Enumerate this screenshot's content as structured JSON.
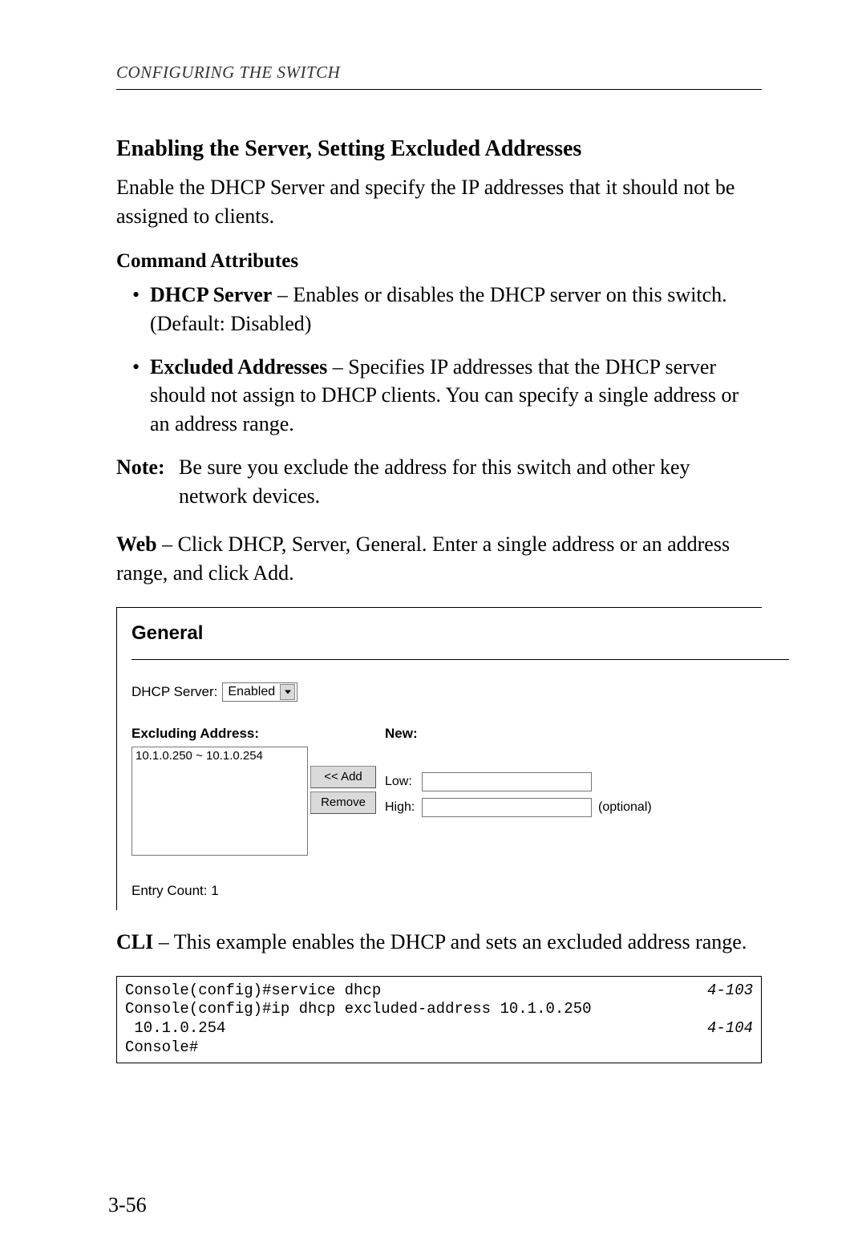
{
  "running_head": "CONFIGURING THE SWITCH",
  "section_title": "Enabling the Server, Setting Excluded Addresses",
  "intro": "Enable the DHCP Server and specify the IP addresses that it should not be assigned to clients.",
  "cmd_attr_title": "Command Attributes",
  "bullets": [
    {
      "bold": "DHCP Server",
      "rest": " – Enables or disables the DHCP server on this switch. (Default: Disabled)"
    },
    {
      "bold": "Excluded Addresses",
      "rest": " – Specifies IP addresses that the DHCP server should not assign to DHCP clients. You can specify a single address or an address range."
    }
  ],
  "note_label": "Note:",
  "note_body": "Be sure you exclude the address for this switch and other key network devices.",
  "web_bold": "Web",
  "web_rest": " – Click DHCP, Server, General. Enter a single address or an address range, and click Add.",
  "ui": {
    "panel_title": "General",
    "dhcp_label": "DHCP Server:",
    "dhcp_value": "Enabled",
    "excluding_label": "Excluding Address:",
    "list_entry": "10.1.0.250 ~ 10.1.0.254",
    "add_btn": "<< Add",
    "remove_btn": "Remove",
    "new_label": "New:",
    "low_label": "Low:",
    "high_label": "High:",
    "optional": "(optional)",
    "entry_count": "Entry Count: 1"
  },
  "cli_bold": "CLI",
  "cli_rest": " – This example enables the DHCP and sets an excluded address range.",
  "cli_lines": [
    {
      "cmd": "Console(config)#service dhcp",
      "ref": "4-103"
    },
    {
      "cmd": "Console(config)#ip dhcp excluded-address 10.1.0.250",
      "ref": ""
    },
    {
      "cmd": " 10.1.0.254",
      "ref": "4-104"
    },
    {
      "cmd": "Console#",
      "ref": ""
    }
  ],
  "page_number": "3-56"
}
